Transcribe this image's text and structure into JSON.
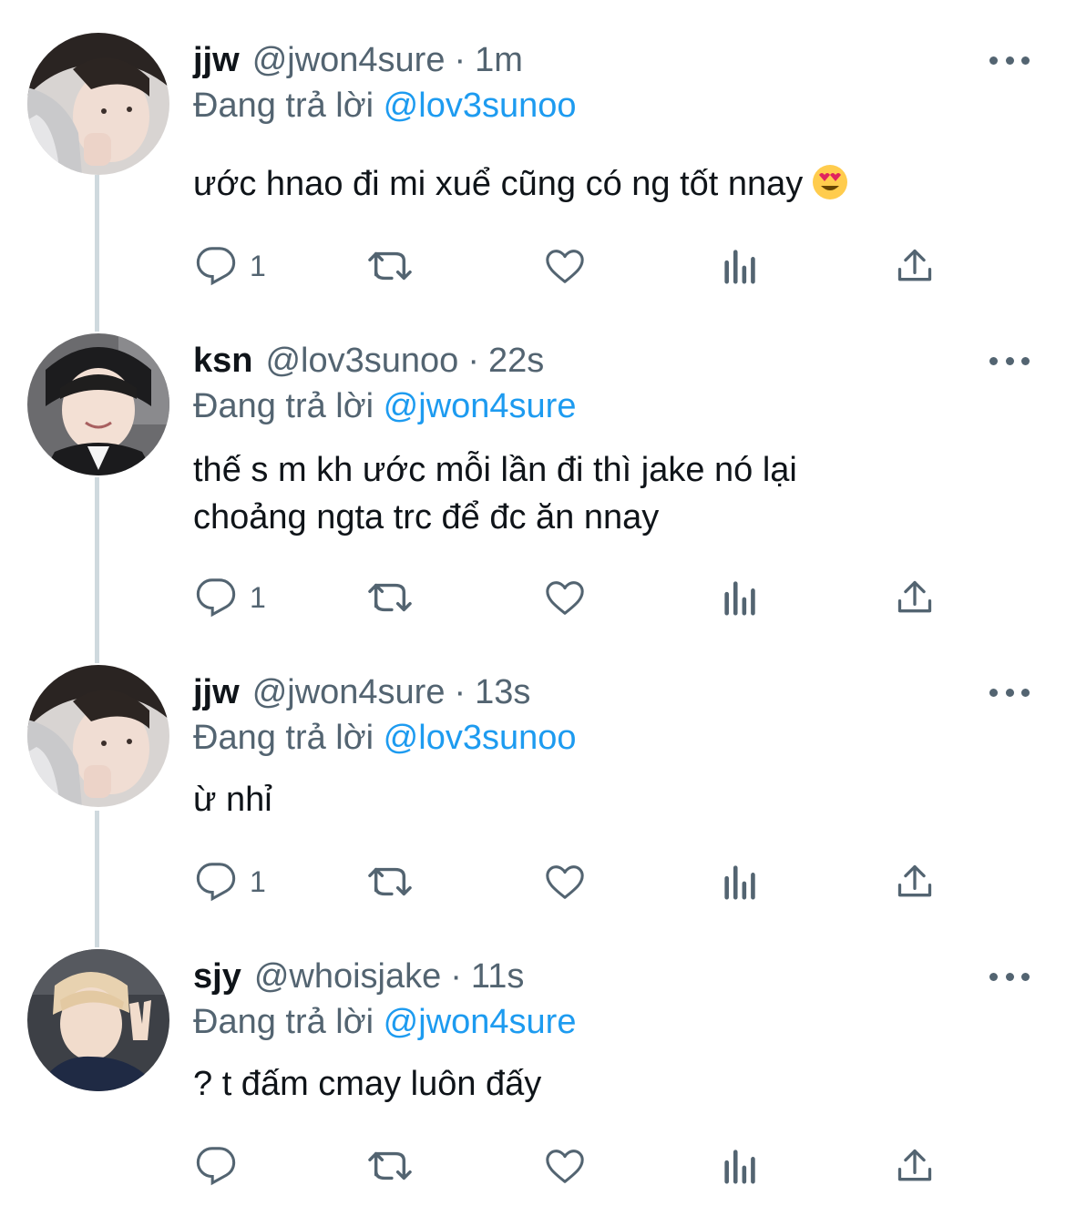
{
  "tweets": [
    {
      "name": "jjw",
      "handle": "@jwon4sure",
      "time": "1m",
      "replying_prefix": "Đang trả lời",
      "replying_to": "@lov3sunoo",
      "text": "ước hnao đi mi xuể cũng có ng tốt nnay",
      "emoji": "smiling-face-with-heart-eyes",
      "reply_count": "1",
      "avatar": "avatar-jjw"
    },
    {
      "name": "ksn",
      "handle": "@lov3sunoo",
      "time": "22s",
      "replying_prefix": "Đang trả lời",
      "replying_to": "@jwon4sure",
      "text_line1": "thế s m kh ước mỗi lần đi thì jake nó lại",
      "text_line2": "choảng ngta trc để đc ăn nnay",
      "reply_count": "1",
      "avatar": "avatar-ksn"
    },
    {
      "name": "jjw",
      "handle": "@jwon4sure",
      "time": "13s",
      "replying_prefix": "Đang trả lời",
      "replying_to": "@lov3sunoo",
      "text": "ừ nhỉ",
      "reply_count": "1",
      "avatar": "avatar-jjw"
    },
    {
      "name": "sjy",
      "handle": "@whoisjake",
      "time": "11s",
      "replying_prefix": "Đang trả lời",
      "replying_to": "@jwon4sure",
      "text": "? t đấm cmay luôn đấy",
      "reply_count": "",
      "avatar": "avatar-sjy"
    }
  ],
  "dot_separator": "·",
  "icons": [
    "reply-icon",
    "retweet-icon",
    "like-icon",
    "analytics-icon",
    "share-icon",
    "more-icon"
  ],
  "colors": {
    "link": "#1d9bf0",
    "secondary": "#536471",
    "thread_line": "#cfd9de"
  }
}
